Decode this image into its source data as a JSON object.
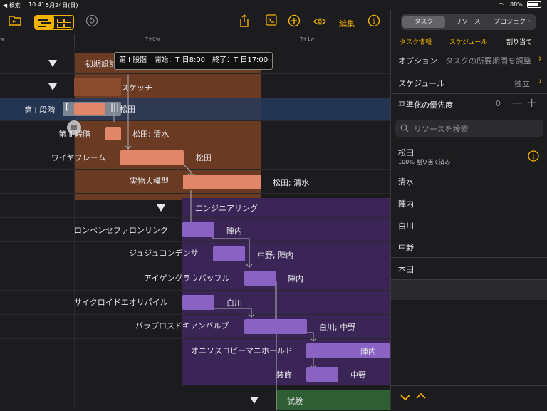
{
  "status": {
    "back": "◀ 検索",
    "time": "10:41",
    "date": "5月24日(日)",
    "battery": "88%"
  },
  "toolbar": {
    "export_label": "編集"
  },
  "timeline": {
    "ticks": [
      "w",
      "T+0w",
      "T+1w"
    ]
  },
  "tooltip": "第 Ⅰ 段階　開始：T 日8:00　終了：T 日17:00",
  "groups": {
    "initial_design": "初期設計",
    "engineering": "エンジニアリング",
    "test": "試験"
  },
  "tasks": [
    {
      "name": "スケッチ",
      "resource": ""
    },
    {
      "name": "第 Ⅰ 段階",
      "resource": "松田"
    },
    {
      "name": "第 Ⅱ 段階",
      "resource": "松田; 清水"
    },
    {
      "name": "ワイヤフレーム",
      "resource": "松田"
    },
    {
      "name": "実物大模型",
      "resource": "松田; 清水"
    },
    {
      "name": "ロンベンセファロンリンク",
      "resource": "陣内"
    },
    {
      "name": "ジュジュコンデンサ",
      "resource": "中野; 陣内"
    },
    {
      "name": "アイゲングラウバッフル",
      "resource": "陣内"
    },
    {
      "name": "サイクロイドエオリパイル",
      "resource": "白川"
    },
    {
      "name": "パラプロスドキアンバルブ",
      "resource": "白川; 中野"
    },
    {
      "name": "オニソスコピーマニホールド",
      "resource": "陣内"
    },
    {
      "name": "装飾",
      "resource": "中野"
    }
  ],
  "panel": {
    "segments": [
      "タスク",
      "リソース",
      "プロジェクト"
    ],
    "subtabs": [
      "タスク情報",
      "スケジュール",
      "割り当て"
    ],
    "option_label": "オプション",
    "option_value": "タスクの所要期間を調整",
    "schedule_label": "スケジュール",
    "schedule_value": "独立",
    "leveling_label": "平準化の優先度",
    "leveling_value": "0",
    "search_placeholder": "リソースを検索",
    "assigned": {
      "name": "松田",
      "detail": "100% 割り当て済み"
    },
    "resources": [
      "清水",
      "陣内",
      "白川",
      "中野",
      "本田"
    ]
  },
  "colors": {
    "accent": "#f2b200",
    "design_bg": "#6b3a22",
    "design_bar": "#e0876a",
    "eng_bg": "#3b2557",
    "eng_bar": "#8a62c4",
    "test_bg": "#2f5e34",
    "selected_row": "#263a5a"
  }
}
